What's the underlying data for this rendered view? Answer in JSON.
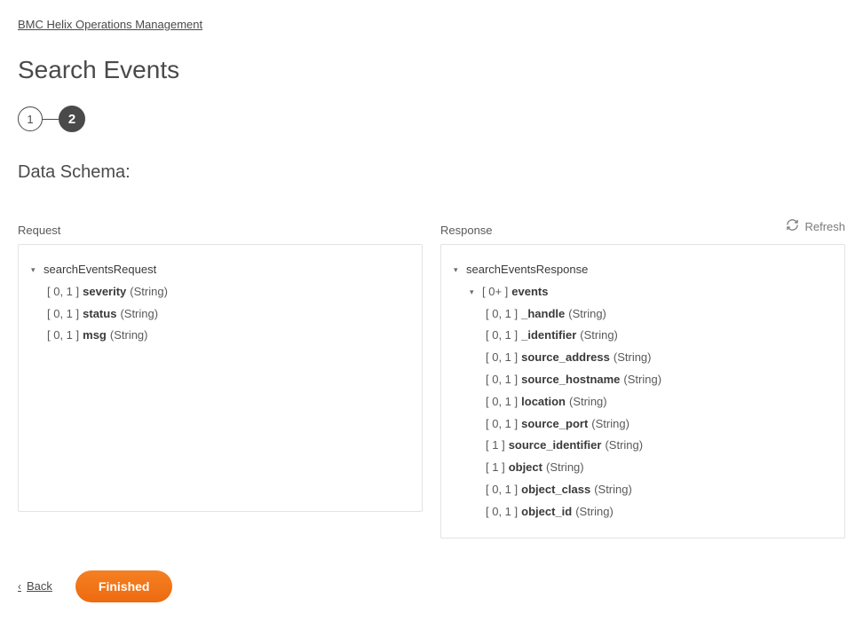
{
  "breadcrumb": "BMC Helix Operations Management",
  "title": "Search Events",
  "steps": {
    "s1": "1",
    "s2": "2"
  },
  "section_heading": "Data Schema:",
  "refresh_label": "Refresh",
  "request": {
    "label": "Request",
    "root": "searchEventsRequest",
    "fields": [
      {
        "card": "[ 0, 1 ]",
        "name": "severity",
        "type": "(String)"
      },
      {
        "card": "[ 0, 1 ]",
        "name": "status",
        "type": "(String)"
      },
      {
        "card": "[ 0, 1 ]",
        "name": "msg",
        "type": "(String)"
      }
    ]
  },
  "response": {
    "label": "Response",
    "root": "searchEventsResponse",
    "events_card": "[ 0+ ]",
    "events_name": "events",
    "fields": [
      {
        "card": "[ 0, 1 ]",
        "name": "_handle",
        "type": "(String)"
      },
      {
        "card": "[ 0, 1 ]",
        "name": "_identifier",
        "type": "(String)"
      },
      {
        "card": "[ 0, 1 ]",
        "name": "source_address",
        "type": "(String)"
      },
      {
        "card": "[ 0, 1 ]",
        "name": "source_hostname",
        "type": "(String)"
      },
      {
        "card": "[ 0, 1 ]",
        "name": "location",
        "type": "(String)"
      },
      {
        "card": "[ 0, 1 ]",
        "name": "source_port",
        "type": "(String)"
      },
      {
        "card": "[ 1 ]",
        "name": "source_identifier",
        "type": "(String)"
      },
      {
        "card": "[ 1 ]",
        "name": "object",
        "type": "(String)"
      },
      {
        "card": "[ 0, 1 ]",
        "name": "object_class",
        "type": "(String)"
      },
      {
        "card": "[ 0, 1 ]",
        "name": "object_id",
        "type": "(String)"
      }
    ]
  },
  "footer": {
    "back": "Back",
    "finished": "Finished"
  }
}
